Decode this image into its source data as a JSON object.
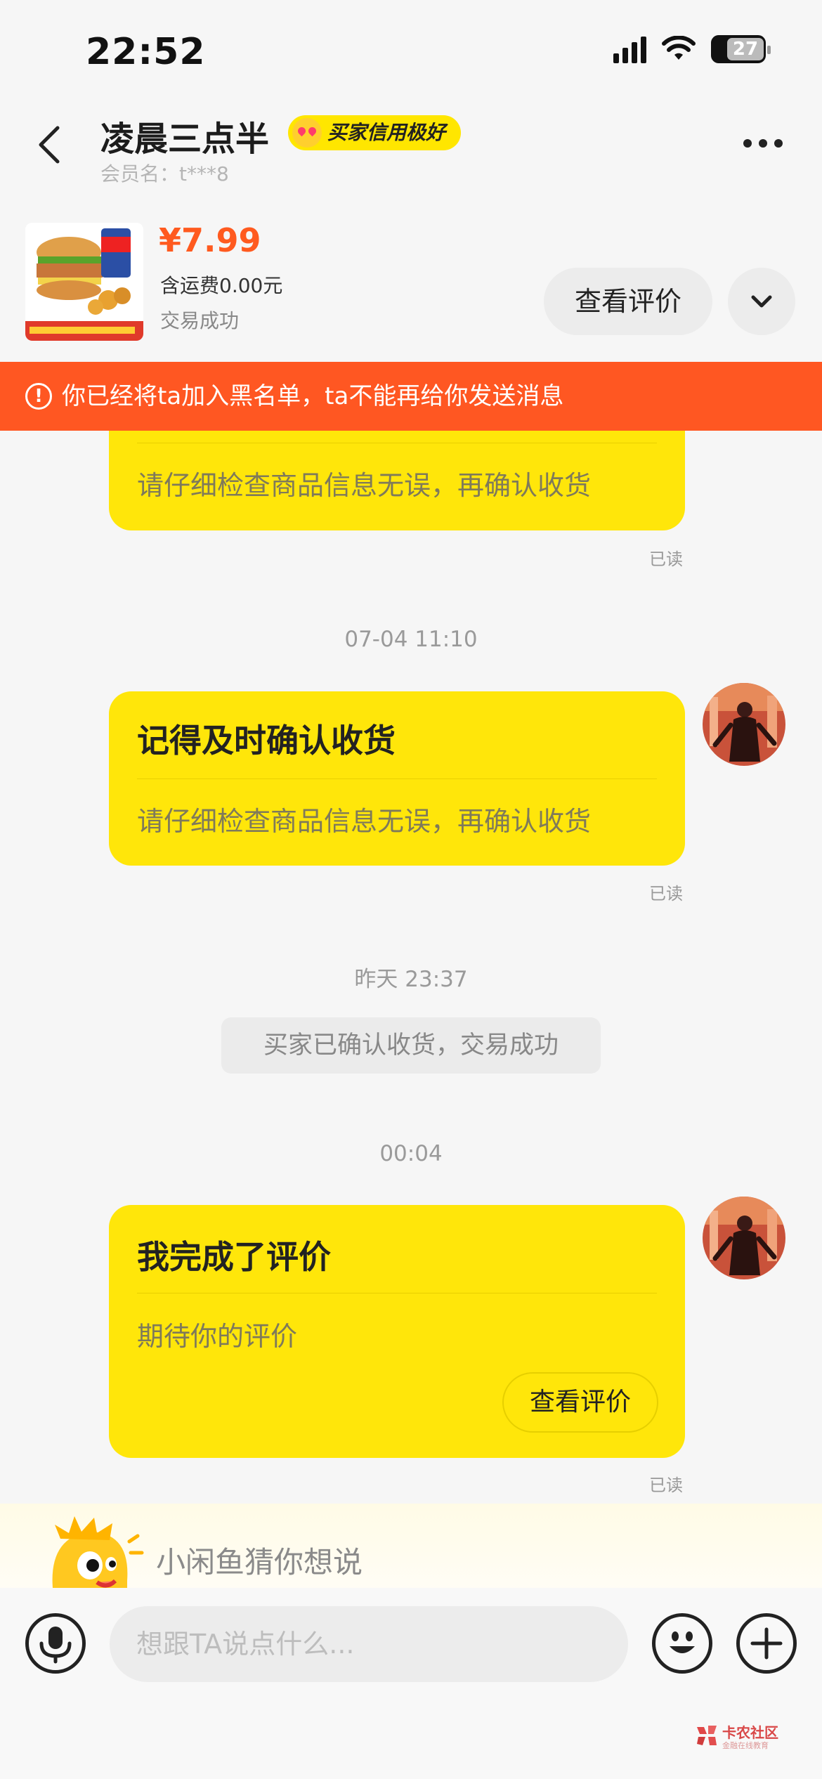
{
  "status_bar": {
    "time": "22:52",
    "battery": "27"
  },
  "header": {
    "name": "凌晨三点半",
    "credit_badge": "买家信用极好",
    "member_label": "会员名：t***8"
  },
  "product": {
    "price": "¥7.99",
    "shipping": "含运费0.00元",
    "status": "交易成功",
    "review_button": "查看评价"
  },
  "banner": {
    "text": "你已经将ta加入黑名单，ta不能再给你发送消息"
  },
  "messages": [
    {
      "body": "请仔细检查商品信息无误，再确认收货",
      "read": "已读"
    },
    {
      "time": "07-04 11:10",
      "title": "记得及时确认收货",
      "body": "请仔细检查商品信息无误，再确认收货",
      "read": "已读"
    },
    {
      "time": "昨天 23:37",
      "system": "买家已确认收货，交易成功"
    },
    {
      "time": "00:04",
      "title": "我完成了评价",
      "body": "期待你的评价",
      "button": "查看评价",
      "read": "已读"
    }
  ],
  "suggestion": {
    "text": "小闲鱼猜你想说"
  },
  "input": {
    "placeholder": "想跟TA说点什么..."
  },
  "watermark": {
    "title": "卡农社区",
    "sub": "金融在线教育"
  },
  "colors": {
    "accent": "#ffe60a",
    "banner": "#ff5722",
    "price": "#ff5a1f"
  },
  "icons": [
    "back-icon",
    "more-icon",
    "chevron-down-icon",
    "microphone-icon",
    "emoji-icon",
    "plus-icon"
  ]
}
